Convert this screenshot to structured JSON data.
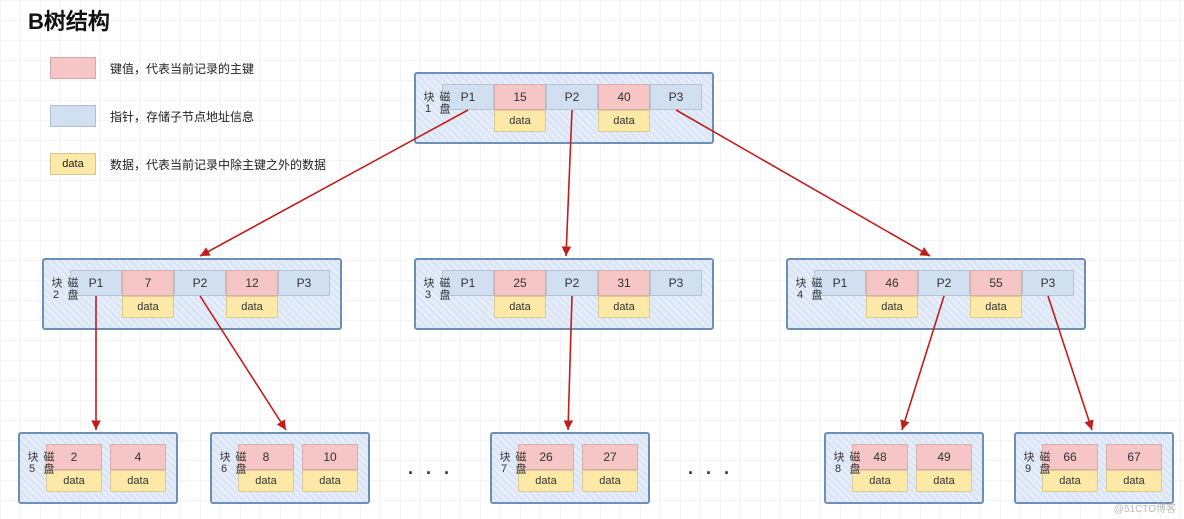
{
  "title": "B树结构",
  "legend": {
    "key": "键值，代表当前记录的主键",
    "ptr": "指针，存储子节点地址信息",
    "data_swatch": "data",
    "data": "数据，代表当前记录中除主键之外的数据"
  },
  "ptr_labels": [
    "P1",
    "P2",
    "P3"
  ],
  "data_label": "data",
  "blocks": {
    "b1": {
      "label": "磁盘块1",
      "keys": [
        "15",
        "40"
      ]
    },
    "b2": {
      "label": "磁盘块2",
      "keys": [
        "7",
        "12"
      ]
    },
    "b3": {
      "label": "磁盘块3",
      "keys": [
        "25",
        "31"
      ]
    },
    "b4": {
      "label": "磁盘块4",
      "keys": [
        "46",
        "55"
      ]
    },
    "b5": {
      "label": "磁盘块5",
      "keys": [
        "2",
        "4"
      ]
    },
    "b6": {
      "label": "磁盘块6",
      "keys": [
        "8",
        "10"
      ]
    },
    "b7": {
      "label": "磁盘块7",
      "keys": [
        "26",
        "27"
      ]
    },
    "b8": {
      "label": "磁盘块8",
      "keys": [
        "48",
        "49"
      ]
    },
    "b9": {
      "label": "磁盘块9",
      "keys": [
        "66",
        "67"
      ]
    }
  },
  "ellipsis": ". . .",
  "watermark": "@51CTO博客",
  "chart_data": {
    "type": "tree",
    "title": "B树结构",
    "nodes": [
      {
        "id": 1,
        "keys": [
          15,
          40
        ],
        "pointers": [
          "P1",
          "P2",
          "P3"
        ],
        "data": [
          "data",
          "data"
        ]
      },
      {
        "id": 2,
        "keys": [
          7,
          12
        ],
        "pointers": [
          "P1",
          "P2",
          "P3"
        ],
        "data": [
          "data",
          "data"
        ]
      },
      {
        "id": 3,
        "keys": [
          25,
          31
        ],
        "pointers": [
          "P1",
          "P2",
          "P3"
        ],
        "data": [
          "data",
          "data"
        ]
      },
      {
        "id": 4,
        "keys": [
          46,
          55
        ],
        "pointers": [
          "P1",
          "P2",
          "P3"
        ],
        "data": [
          "data",
          "data"
        ]
      },
      {
        "id": 5,
        "keys": [
          2,
          4
        ],
        "data": [
          "data",
          "data"
        ]
      },
      {
        "id": 6,
        "keys": [
          8,
          10
        ],
        "data": [
          "data",
          "data"
        ]
      },
      {
        "id": 7,
        "keys": [
          26,
          27
        ],
        "data": [
          "data",
          "data"
        ]
      },
      {
        "id": 8,
        "keys": [
          48,
          49
        ],
        "data": [
          "data",
          "data"
        ]
      },
      {
        "id": 9,
        "keys": [
          66,
          67
        ],
        "data": [
          "data",
          "data"
        ]
      }
    ],
    "edges": [
      {
        "from": 1,
        "via": "P1",
        "to": 2
      },
      {
        "from": 1,
        "via": "P2",
        "to": 3
      },
      {
        "from": 1,
        "via": "P3",
        "to": 4
      },
      {
        "from": 2,
        "via": "P1",
        "to": 5
      },
      {
        "from": 2,
        "via": "P2",
        "to": 6
      },
      {
        "from": 3,
        "via": "P2",
        "to": 7
      },
      {
        "from": 4,
        "via": "P2",
        "to": 8
      },
      {
        "from": 4,
        "via": "P3",
        "to": 9
      }
    ],
    "legend": {
      "pink": "键值，代表当前记录的主键",
      "blue": "指针，存储子节点地址信息",
      "yellow": "数据，代表当前记录中除主键之外的数据"
    }
  }
}
